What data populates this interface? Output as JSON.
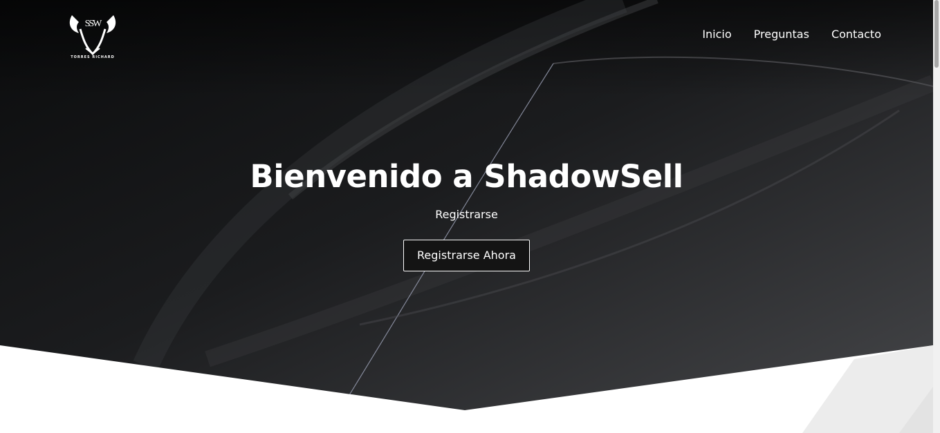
{
  "header": {
    "logo": {
      "monogram": "SSW",
      "caption": "TORRES RICHARD"
    },
    "nav": [
      {
        "label": "Inicio"
      },
      {
        "label": "Preguntas"
      },
      {
        "label": "Contacto"
      }
    ]
  },
  "hero": {
    "title": "Bienvenido a ShadowSell",
    "subtitle": "Registrarse",
    "cta_label": "Registrarse Ahora"
  },
  "colors": {
    "hero_dark": "#0c0d0e",
    "hero_mid": "#2d2e31",
    "text": "#ffffff",
    "page_bg": "#ffffff"
  }
}
